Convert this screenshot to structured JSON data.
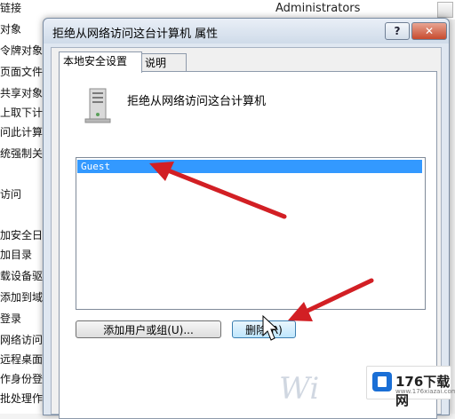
{
  "background": {
    "admin_label": "Administrators",
    "left_items": [
      "链接",
      "对象",
      "令牌对象",
      "页面文件",
      "共享对象",
      "上取下计算",
      "问此计算机",
      "统强制关机",
      "",
      "访问",
      "",
      "加安全日志",
      "加目录",
      "载设备驱动",
      "添加到域",
      "登录",
      "网络访问这台",
      "远程桌面服",
      "作身份登录",
      "批处理作业"
    ]
  },
  "dialog": {
    "title": "拒绝从网络访问这台计算机 属性",
    "help_label": "?",
    "close_label": "✕",
    "tabs": [
      "本地安全设置",
      "说明"
    ],
    "policy_name": "拒绝从网络访问这台计算机",
    "list_items": [
      "Guest"
    ],
    "add_button": "添加用户或组(U)...",
    "remove_button": "删除(R)"
  },
  "watermark": "Wi",
  "logo": {
    "text": "176下载网",
    "subtext": "www.176xiazai.com"
  },
  "colors": {
    "selection": "#3399ff",
    "arrow": "#d21f24"
  }
}
